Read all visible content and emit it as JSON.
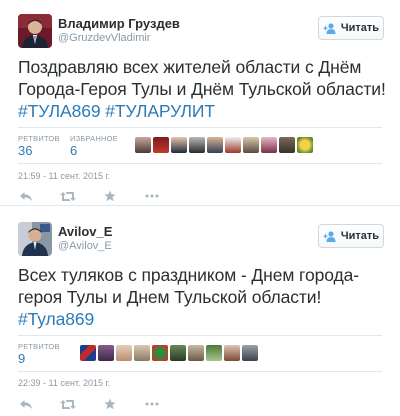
{
  "tweets": [
    {
      "author_name": "Владимир Груздев",
      "handle": "@GruzdevVladimir",
      "follow_label": "Читать",
      "text_plain": "Поздравляю всех жителей области с Днём Города-Героя Тулы и Днём Тульской области! ",
      "hashtags": [
        "#ТУЛА869",
        "#ТУЛАРУЛИТ"
      ],
      "stats": [
        {
          "label": "РЕТВИТОВ",
          "value": "36"
        },
        {
          "label": "ИЗБРАННОЕ",
          "value": "6"
        }
      ],
      "timestamp": "21:59 - 11 сент. 2015 г."
    },
    {
      "author_name": "Avilov_E",
      "handle": "@Avilov_E",
      "follow_label": "Читать",
      "text_plain": "Всех туляков с праздником - Днем города-героя Тулы и Днем Тульской области!  ",
      "hashtags": [
        "#Тула869"
      ],
      "stats": [
        {
          "label": "РЕТВИТОВ",
          "value": "9"
        }
      ],
      "timestamp": "22:39 - 11 сент. 2015 г."
    }
  ],
  "icons": {
    "follow": "add-user-icon",
    "reply": "reply-icon",
    "retweet": "retweet-icon",
    "favorite": "star-icon",
    "more": "more-icon"
  },
  "colors": {
    "link": "#2b7bb9",
    "meta": "#8899a6",
    "text": "#292f33",
    "divider": "#e1e8ed"
  }
}
